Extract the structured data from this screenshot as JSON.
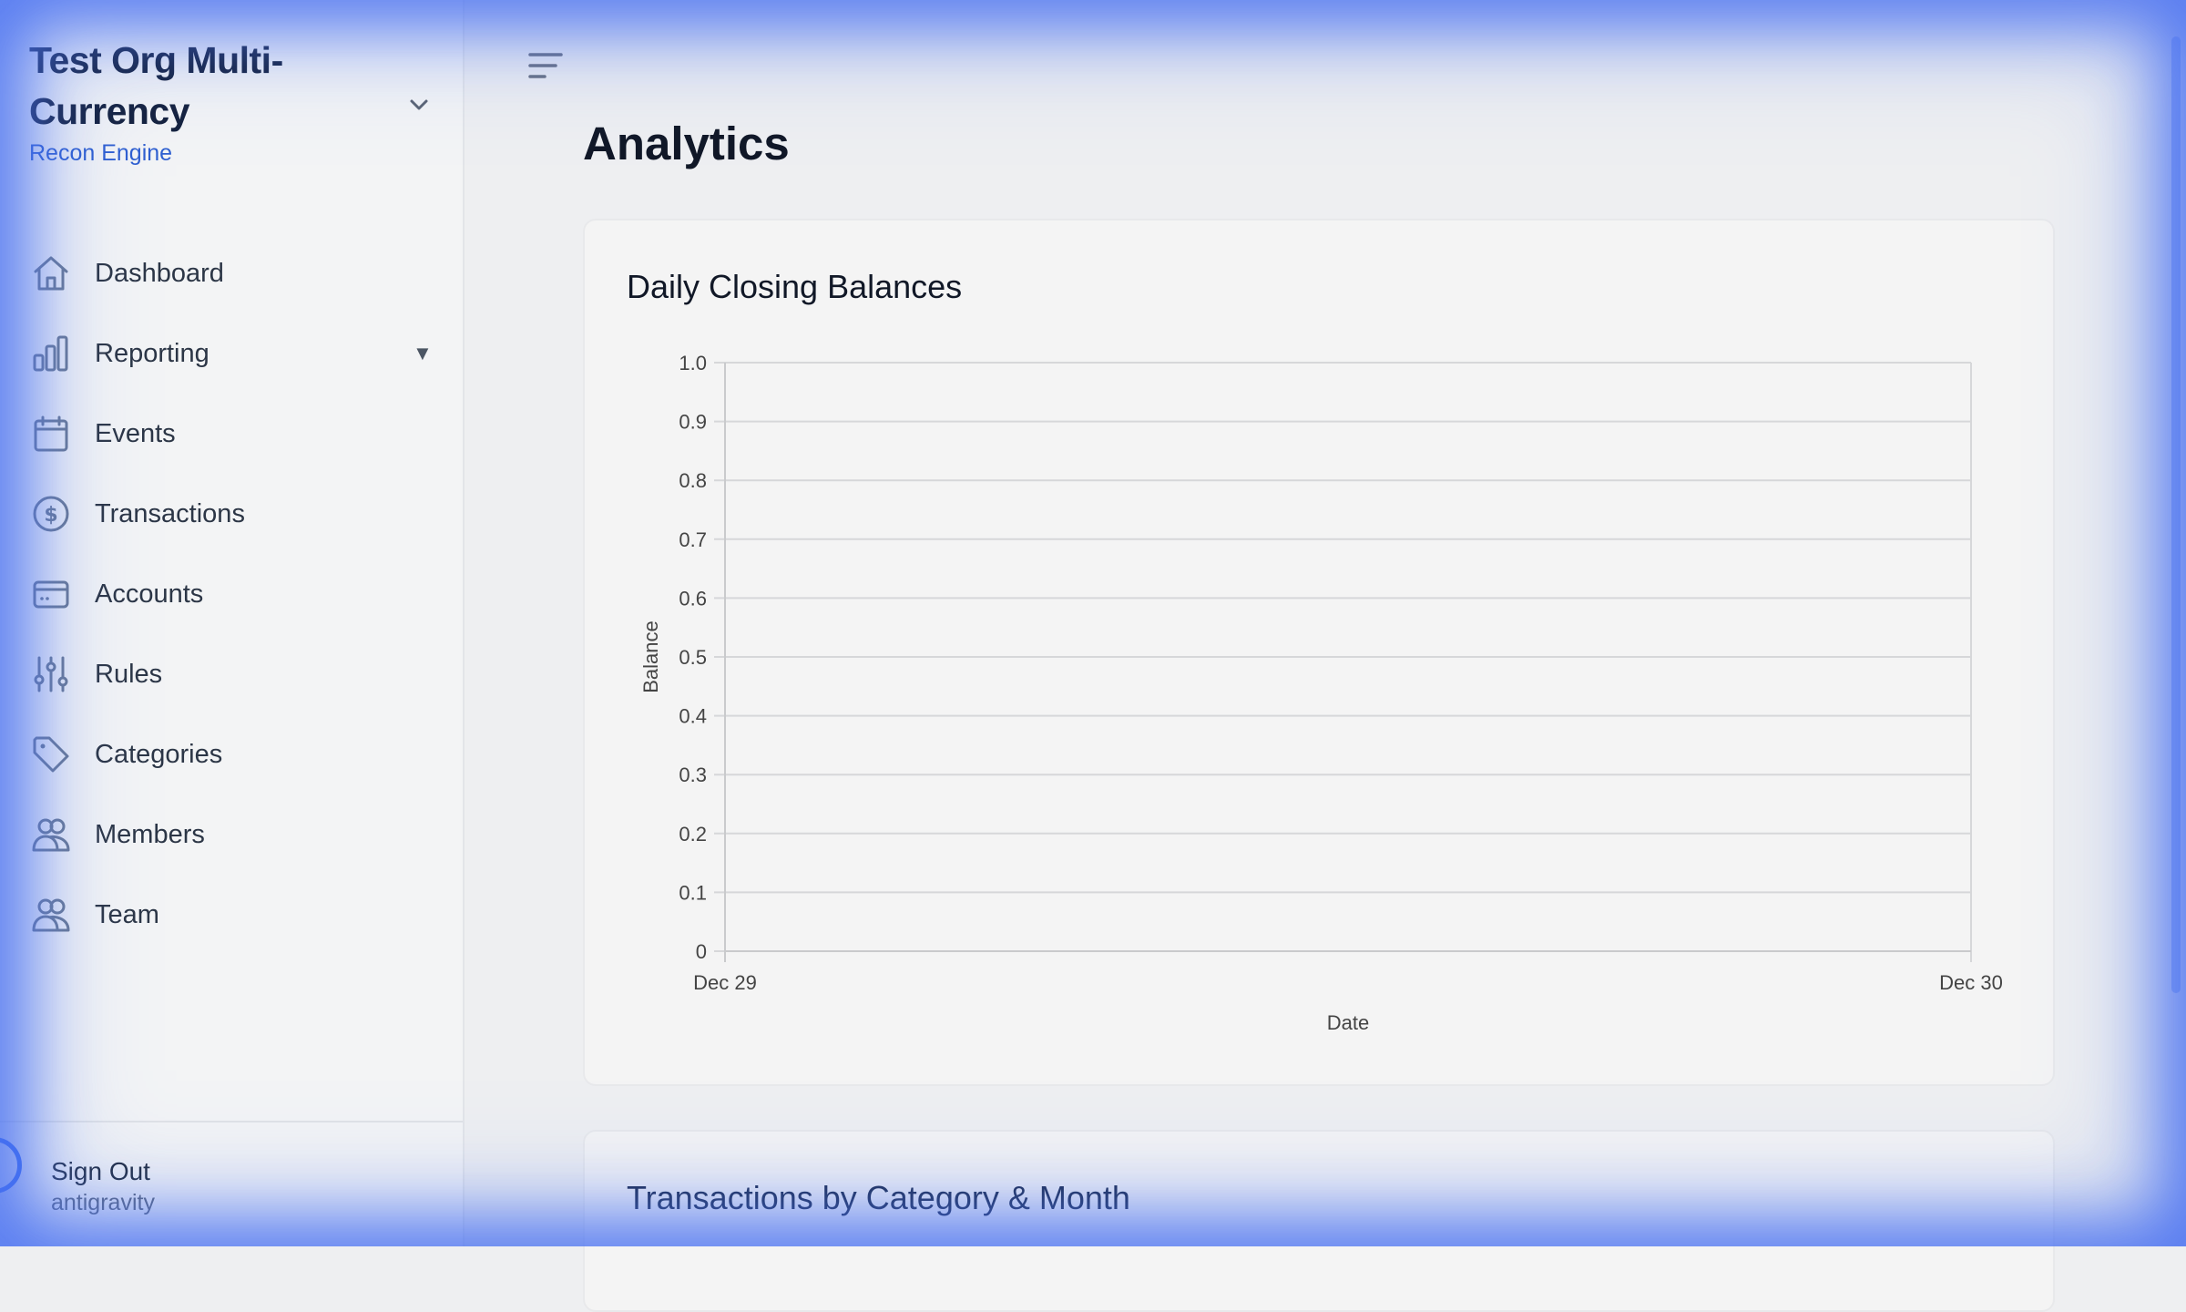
{
  "sidebar": {
    "org_name": "Test Org Multi-Currency",
    "org_subtitle": "Recon Engine",
    "items": [
      {
        "label": "Dashboard",
        "icon": "home-icon"
      },
      {
        "label": "Reporting",
        "icon": "bar-chart-icon",
        "caret": "▼"
      },
      {
        "label": "Events",
        "icon": "calendar-icon"
      },
      {
        "label": "Transactions",
        "icon": "dollar-circle-icon"
      },
      {
        "label": "Accounts",
        "icon": "card-icon"
      },
      {
        "label": "Rules",
        "icon": "sliders-icon"
      },
      {
        "label": "Categories",
        "icon": "tag-icon"
      },
      {
        "label": "Members",
        "icon": "users-icon"
      },
      {
        "label": "Team",
        "icon": "users-icon"
      }
    ],
    "footer": {
      "sign_out": "Sign Out",
      "username": "antigravity"
    }
  },
  "main": {
    "title": "Analytics",
    "cards": [
      {
        "title": "Daily Closing Balances"
      },
      {
        "title": "Transactions by Category & Month"
      }
    ]
  },
  "colors": {
    "accent": "#2f5fd0",
    "glow": "#466ef0"
  },
  "chart_data": {
    "type": "line",
    "title": "Daily Closing Balances",
    "xlabel": "Date",
    "ylabel": "Balance",
    "x": [
      "Dec 29",
      "Dec 30"
    ],
    "ylim": [
      0,
      1
    ],
    "yticks": [
      "0",
      "0.1",
      "0.2",
      "0.3",
      "0.4",
      "0.5",
      "0.6",
      "0.7",
      "0.8",
      "0.9",
      "1.0"
    ],
    "series": [],
    "grid": true
  }
}
